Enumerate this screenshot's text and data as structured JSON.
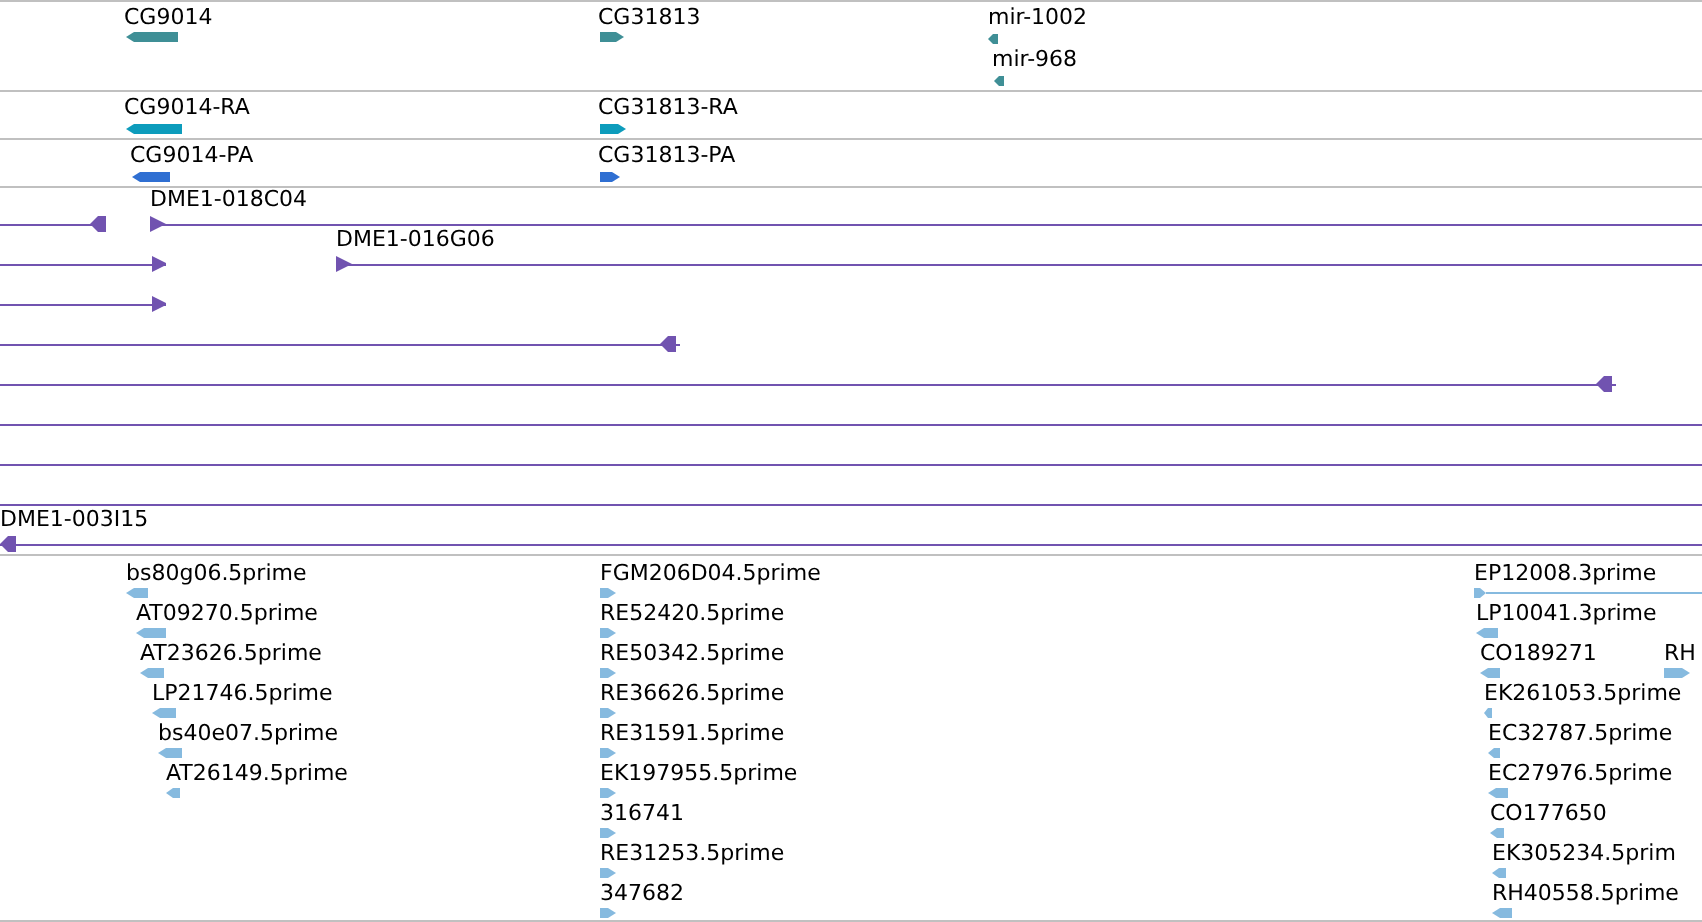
{
  "tracks": [
    {
      "kind": "gene",
      "features": [
        {
          "label": "CG9014",
          "reverse": true
        },
        {
          "label": "CG31813",
          "reverse": false
        },
        {
          "label": "mir-1002",
          "reverse": true
        },
        {
          "label": "mir-968",
          "reverse": true
        }
      ]
    },
    {
      "kind": "transcript",
      "features": [
        {
          "label": "CG9014-RA",
          "reverse": true
        },
        {
          "label": "CG31813-RA",
          "reverse": false
        }
      ]
    },
    {
      "kind": "protein",
      "features": [
        {
          "label": "CG9014-PA",
          "reverse": true
        },
        {
          "label": "CG31813-PA",
          "reverse": false
        }
      ]
    },
    {
      "kind": "clone",
      "features": [
        {
          "kind": "arrow",
          "reverse": true
        },
        {
          "kind": "arrow",
          "label": "DME1-018C04",
          "reverse": false
        },
        {
          "kind": "arrow",
          "reverse": false
        },
        {
          "kind": "arrow",
          "label": "DME1-016G06",
          "reverse": false
        },
        {
          "kind": "arrow",
          "reverse": false
        },
        {
          "kind": "arrow",
          "reverse": true
        },
        {
          "kind": "arrow",
          "reverse": true
        },
        {
          "kind": "line"
        },
        {
          "kind": "line"
        },
        {
          "kind": "line"
        },
        {
          "kind": "arrow",
          "label": "DME1-003I15",
          "reverse": true
        }
      ]
    },
    {
      "kind": "est",
      "features": [
        {
          "label": "bs80g06.5prime",
          "reverse": true
        },
        {
          "label": "AT09270.5prime",
          "reverse": true
        },
        {
          "label": "AT23626.5prime",
          "reverse": true
        },
        {
          "label": "LP21746.5prime",
          "reverse": true
        },
        {
          "label": "bs40e07.5prime",
          "reverse": true
        },
        {
          "label": "AT26149.5prime",
          "reverse": true
        },
        {
          "label": "FGM206D04.5prime",
          "reverse": false
        },
        {
          "label": "RE52420.5prime",
          "reverse": false
        },
        {
          "label": "RE50342.5prime",
          "reverse": false
        },
        {
          "label": "RE36626.5prime",
          "reverse": false
        },
        {
          "label": "RE31591.5prime",
          "reverse": false
        },
        {
          "label": "EK197955.5prime",
          "reverse": false
        },
        {
          "label": "316741",
          "reverse": false
        },
        {
          "label": "RE31253.5prime",
          "reverse": false
        },
        {
          "label": "347682",
          "reverse": false
        },
        {
          "label": "EP12008.3prime",
          "reverse": false
        },
        {
          "label": "LP10041.3prime",
          "reverse": true
        },
        {
          "label": "CO189271",
          "reverse": true
        },
        {
          "label": "RH",
          "reverse": false
        },
        {
          "label": "EK261053.5prime",
          "reverse": true
        },
        {
          "label": "EC32787.5prime",
          "reverse": true
        },
        {
          "label": "EC27976.5prime",
          "reverse": true
        },
        {
          "label": "CO177650",
          "reverse": true
        },
        {
          "label": "EK305234.5prim",
          "reverse": true
        },
        {
          "label": "RH40558.5prime",
          "reverse": true
        }
      ]
    }
  ]
}
